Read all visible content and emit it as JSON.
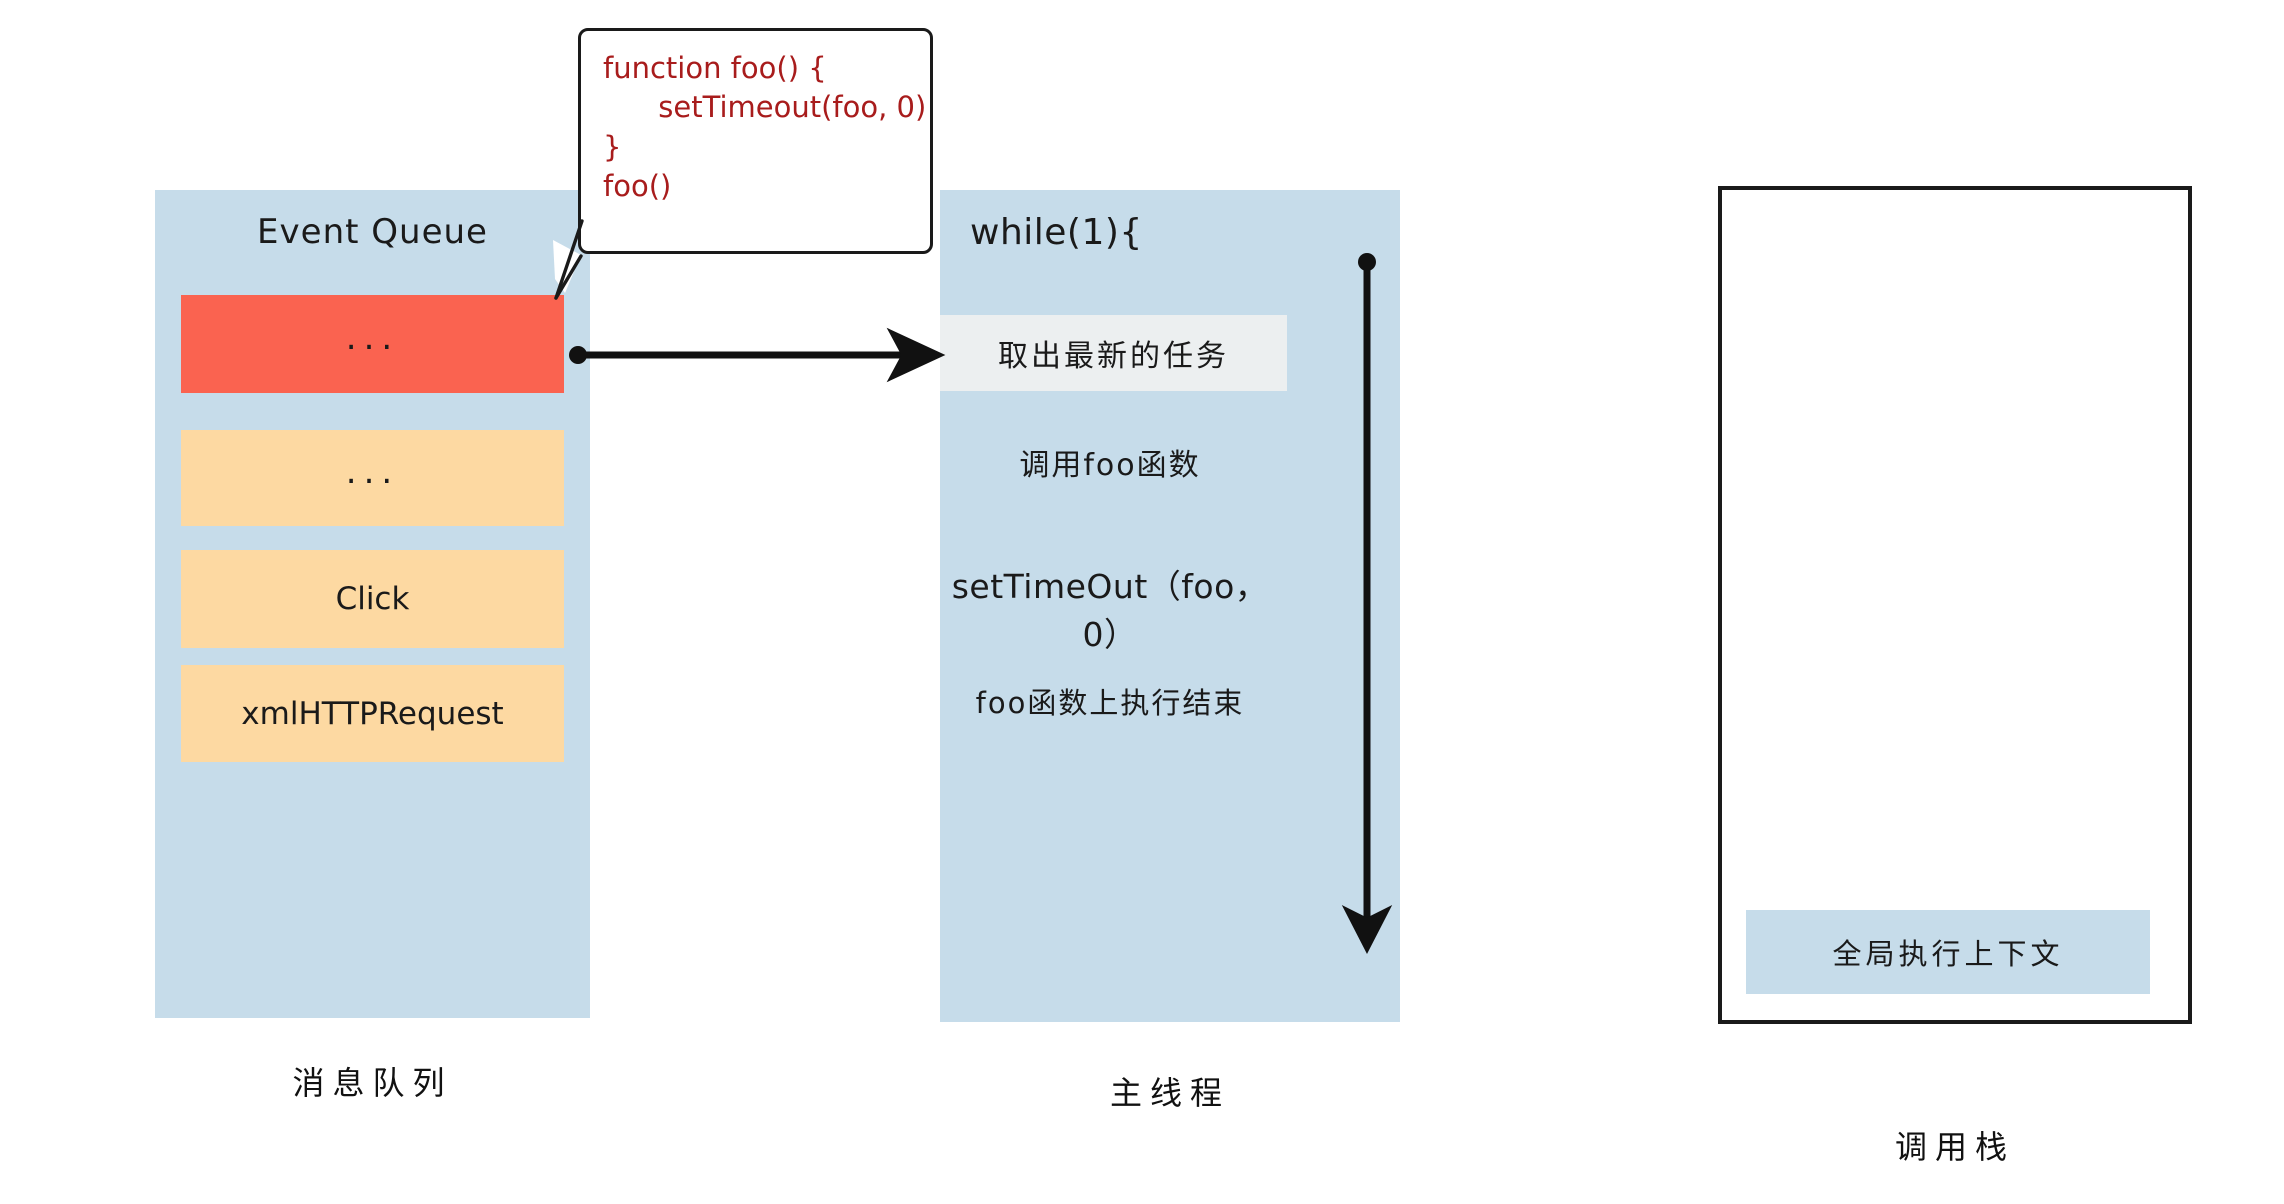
{
  "diagram": {
    "title": "JavaScript Event Loop / Message Queue Diagram"
  },
  "queue_panel": {
    "title": "Event Queue",
    "caption": "消息队列",
    "background_color": "#c6dcea",
    "items": [
      {
        "label": "...",
        "color": "#fa6350",
        "state": "active"
      },
      {
        "label": "...",
        "color": "#fdd9a2",
        "state": "pending"
      },
      {
        "label": "Click",
        "color": "#fdd9a2",
        "state": "pending"
      },
      {
        "label": "xmlHTTPRequest",
        "color": "#fdd9a2",
        "state": "pending"
      }
    ]
  },
  "thread_panel": {
    "caption": "主线程",
    "background_color": "#c6dcea",
    "loop_header": "while(1){",
    "steps": [
      {
        "label": "取出最新的任务",
        "highlight": true,
        "highlight_color": "#eceff0"
      },
      {
        "label": "调用foo函数",
        "highlight": false
      },
      {
        "label": "setTimeOut（foo，0）",
        "highlight": false
      },
      {
        "label": "foo函数上执行结束",
        "highlight": false
      }
    ]
  },
  "stack_panel": {
    "caption": "调用栈",
    "border_color": "#1a1a1a",
    "frames": [
      {
        "label": "全局执行上下文",
        "color": "#c6dcea"
      }
    ]
  },
  "callout": {
    "code": "function foo() {\n      setTimeout(foo, 0)\n}\nfoo()",
    "text_color": "#a81c1c",
    "border_color": "#1a1a1a"
  },
  "arrows": {
    "queue_to_thread": "dequeue-task-arrow",
    "loop_down": "loop-iteration-arrow",
    "callout_tail": "callout-pointer"
  }
}
